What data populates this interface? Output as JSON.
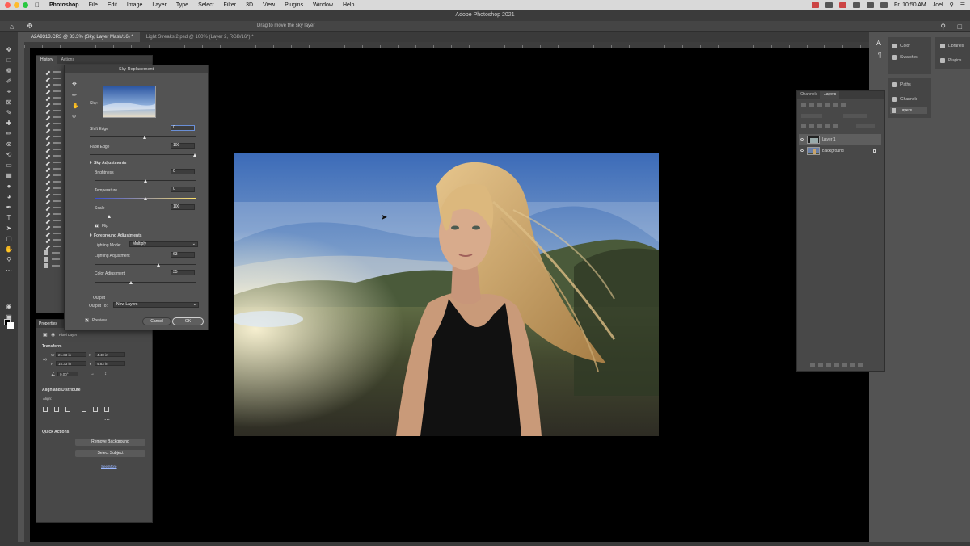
{
  "menubar": {
    "app": "Photoshop",
    "items": [
      "File",
      "Edit",
      "Image",
      "Layer",
      "Type",
      "Select",
      "Filter",
      "3D",
      "View",
      "Plugins",
      "Window",
      "Help"
    ],
    "clock": "Fri 10:50 AM",
    "user": "Joel"
  },
  "window": {
    "title": "Adobe Photoshop 2021"
  },
  "options": {
    "hint": "Drag to move the sky layer"
  },
  "tabs": [
    {
      "label": "A2A9313.CR3 @ 33.3% (Sky, Layer Mask/16) *",
      "active": true
    },
    {
      "label": "Light Streaks 2.psd @ 100% (Layer 2, RGB/16*) *",
      "active": false
    }
  ],
  "history": {
    "tabs": [
      "History",
      "Actions"
    ]
  },
  "properties": {
    "title": "Properties",
    "subtitle": "Pixel Layer",
    "transform": {
      "heading": "Transform",
      "w_label": "W",
      "w_value": "21.33 in",
      "h_label": "H",
      "h_value": "15.33 in",
      "x_label": "X",
      "x_value": "4.48 in",
      "y_label": "Y",
      "y_value": "4.83 in",
      "angle": "0.00°"
    },
    "align": {
      "heading": "Align and Distribute",
      "sub": "Align:"
    },
    "quick": {
      "heading": "Quick Actions",
      "remove_bg": "Remove Background",
      "select_subject": "Select Subject",
      "see_more": "See More"
    }
  },
  "sky_dialog": {
    "title": "Sky Replacement",
    "sky_label": "Sky:",
    "shift_edge": {
      "label": "Shift Edge",
      "value": "0"
    },
    "fade_edge": {
      "label": "Fade Edge",
      "value": "100"
    },
    "sky_adjustments": "Sky Adjustments",
    "brightness": {
      "label": "Brightness",
      "value": "0"
    },
    "temperature": {
      "label": "Temperature",
      "value": "0"
    },
    "scale": {
      "label": "Scale",
      "value": "100"
    },
    "flip": "Flip",
    "foreground": "Foreground Adjustments",
    "lighting_mode": {
      "label": "Lighting Mode:",
      "value": "Multiply"
    },
    "lighting_adj": {
      "label": "Lighting Adjustment",
      "value": "63"
    },
    "color_adj": {
      "label": "Color Adjustment",
      "value": "35"
    },
    "output": "Output",
    "output_to": {
      "label": "Output To:",
      "value": "New Layers"
    },
    "preview": "Preview",
    "cancel": "Cancel",
    "ok": "OK"
  },
  "layers_panel": {
    "tabs": [
      "Channels",
      "Layers"
    ],
    "layers": [
      {
        "name": "Layer 1",
        "selected": true
      },
      {
        "name": "Background",
        "selected": false
      }
    ]
  },
  "dock": {
    "color": "Color",
    "swatches": "Swatches",
    "paths": "Paths",
    "channels": "Channels",
    "layers": "Layers",
    "libraries": "Libraries",
    "plugins": "Plugins"
  },
  "colors": {
    "canvas": "#000000",
    "panel": "#484848",
    "dialog": "#535353",
    "sky_top": "#3f6fb8",
    "hair": "#c9a46a"
  },
  "slider_positions": {
    "shift_edge": 0.5,
    "fade_edge": 0.98,
    "brightness": 0.5,
    "temperature": 0.5,
    "scale": 0.13,
    "lighting_adjustment": 0.63,
    "color_adjustment": 0.35
  }
}
